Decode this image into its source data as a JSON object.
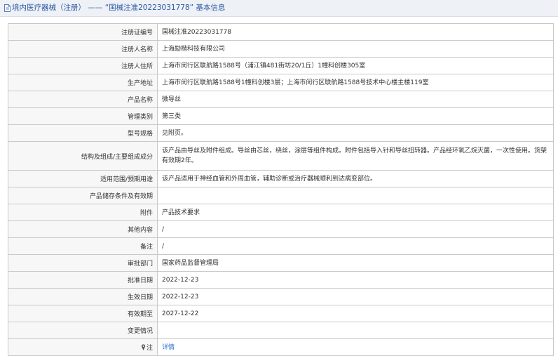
{
  "header": {
    "icon": "document-icon",
    "prefix": "境内医疗器械（注册）",
    "sep": "——",
    "highlight": "“国械注准20223031778”",
    "suffix": "基本信息"
  },
  "rows": [
    {
      "label": "注册证编号",
      "value": "国械注准20223031778"
    },
    {
      "label": "注册人名称",
      "value": "上海励楷科技有限公司"
    },
    {
      "label": "注册人住所",
      "value": "上海市闵行区联航路1588号（浦江镇481街坊20/1丘）1幢科创楼305室"
    },
    {
      "label": "生产地址",
      "value": "上海市闵行区联航路1588号1幢科创楼3层；上海市闵行区联航路1588号技术中心楼主楼119室"
    },
    {
      "label": "产品名称",
      "value": "微导丝"
    },
    {
      "label": "管理类别",
      "value": "第三类"
    },
    {
      "label": "型号规格",
      "value": "见附页。"
    },
    {
      "label": "结构及组成/主要组成成分",
      "value": "该产品由导丝及附件组成。导丝由芯丝，绕丝，涂层等组件构成。附件包括导入针和导丝扭转器。产品经环氧乙烷灭菌，一次性使用。货架有效期2年。"
    },
    {
      "label": "适用范围/预期用途",
      "value": "该产品适用于神经血管和外周血管，辅助诊断或治疗器械顺利到达病变部位。"
    },
    {
      "label": "产品储存条件及有效期",
      "value": ""
    },
    {
      "label": "附件",
      "value": "产品技术要求"
    },
    {
      "label": "其他内容",
      "value": "/"
    },
    {
      "label": "备注",
      "value": "/"
    },
    {
      "label": "审批部门",
      "value": "国家药品监督管理局"
    },
    {
      "label": "批准日期",
      "value": "2022-12-23"
    },
    {
      "label": "生效日期",
      "value": "2022-12-23"
    },
    {
      "label": "有效期至",
      "value": "2027-12-22"
    },
    {
      "label": "变更情况",
      "value": ""
    }
  ],
  "note_row": {
    "icon": "note-pin-icon",
    "label": "注",
    "link": "详情"
  },
  "colors": {
    "header_bg": "#eef1f6",
    "header_text": "#2b58a3",
    "link": "#2b6ed1",
    "border": "#c9c9c9"
  }
}
